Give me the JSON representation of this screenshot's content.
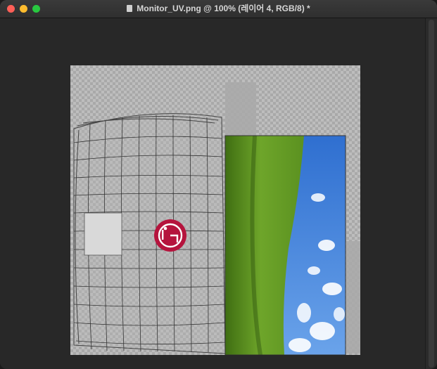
{
  "window": {
    "title": "Monitor_UV.png @ 100% (레이어 4, RGB/8) *"
  },
  "canvas": {
    "logo_text": "LG"
  },
  "colors": {
    "logo_red": "#b5143d",
    "sky": "#3f7fd6",
    "grass": "#5a8f20"
  }
}
